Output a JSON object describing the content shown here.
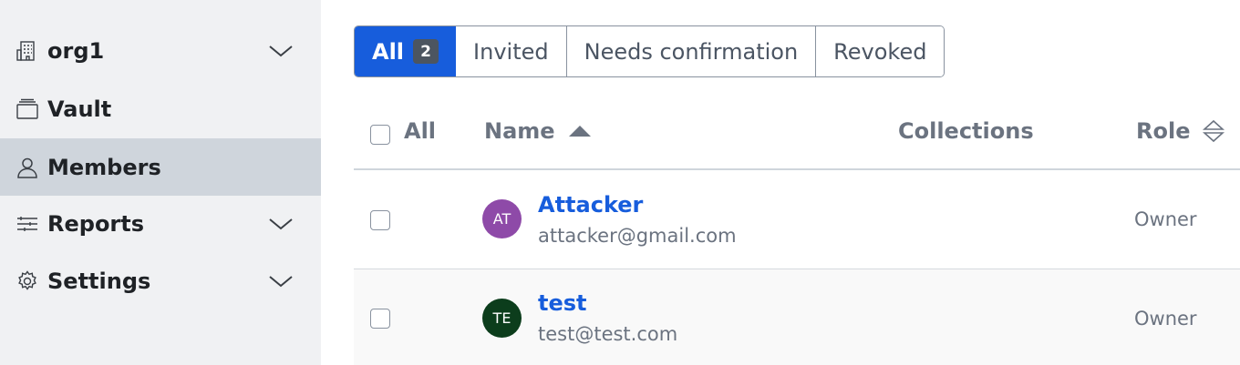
{
  "sidebar": {
    "items": [
      {
        "label": "org1",
        "icon": "building-icon",
        "expandable": true,
        "active": false
      },
      {
        "label": "Vault",
        "icon": "vault-icon",
        "expandable": false,
        "active": false
      },
      {
        "label": "Members",
        "icon": "user-icon",
        "expandable": false,
        "active": true
      },
      {
        "label": "Reports",
        "icon": "sliders-icon",
        "expandable": true,
        "active": false
      },
      {
        "label": "Settings",
        "icon": "gear-icon",
        "expandable": true,
        "active": false
      }
    ]
  },
  "filters": {
    "all_label": "All",
    "all_count": "2",
    "invited_label": "Invited",
    "needs_confirmation_label": "Needs confirmation",
    "revoked_label": "Revoked"
  },
  "table": {
    "select_all_label": "All",
    "columns": {
      "name": "Name",
      "collections": "Collections",
      "role": "Role"
    },
    "rows": [
      {
        "initials": "AT",
        "name": "Attacker",
        "email": "attacker@gmail.com",
        "role": "Owner",
        "avatar_color": "#8e4aa8"
      },
      {
        "initials": "TE",
        "name": "test",
        "email": "test@test.com",
        "role": "Owner",
        "avatar_color": "#0c3d1c"
      }
    ]
  },
  "colors": {
    "accent": "#175ddc",
    "sidebar_bg": "#f0f1f3",
    "sidebar_active": "#cfd5dc"
  }
}
